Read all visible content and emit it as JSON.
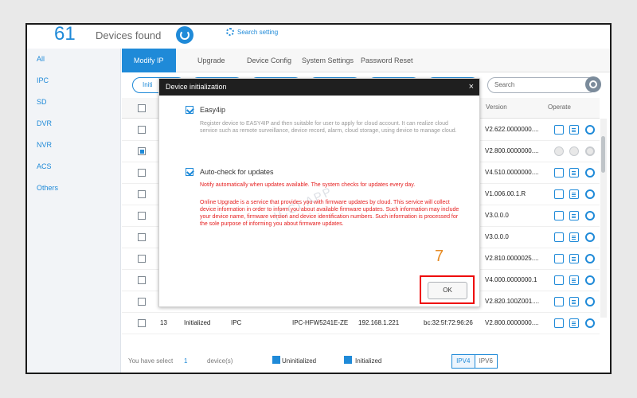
{
  "top": {
    "count": "61",
    "found_label": "Devices found",
    "search_setting": "Search setting"
  },
  "sidebar": {
    "items": [
      {
        "label": "All"
      },
      {
        "label": "IPC"
      },
      {
        "label": "SD"
      },
      {
        "label": "DVR"
      },
      {
        "label": "NVR"
      },
      {
        "label": "ACS"
      },
      {
        "label": "Others"
      }
    ]
  },
  "tabs": [
    {
      "label": "Modify IP"
    },
    {
      "label": "Upgrade"
    },
    {
      "label": "Device Config"
    },
    {
      "label": "System Settings"
    },
    {
      "label": "Password Reset"
    }
  ],
  "toolbar": {
    "visible_button_label": "Initi",
    "search_placeholder": "Search"
  },
  "table": {
    "version_header": "Version",
    "operate_header": "Operate",
    "rows": [
      {
        "version": "V2.622.0000000....",
        "selected": false,
        "operate_enabled": true
      },
      {
        "version": "V2.800.0000000....",
        "selected": true,
        "operate_enabled": false
      },
      {
        "version": "V4.510.0000000....",
        "selected": false,
        "operate_enabled": true
      },
      {
        "version": "V1.006.00.1.R",
        "selected": false,
        "operate_enabled": true
      },
      {
        "version": "V3.0.0.0",
        "selected": false,
        "operate_enabled": true
      },
      {
        "version": "V3.0.0.0",
        "selected": false,
        "operate_enabled": true
      },
      {
        "version": "V2.810.0000025....",
        "selected": false,
        "operate_enabled": true
      },
      {
        "version": "V4.000.0000000.1",
        "selected": false,
        "operate_enabled": true
      },
      {
        "version": "V2.820.100Z001....",
        "selected": false,
        "operate_enabled": true
      }
    ],
    "last_row": {
      "no": "13",
      "status": "Initialized",
      "type": "IPC",
      "model": "IPC-HFW5241E-ZE",
      "ip": "192.168.1.221",
      "mac": "bc:32:5f:72:96:26",
      "version": "V2.800.0000000...."
    }
  },
  "footer": {
    "selected_prefix": "You have select",
    "selected_count": "1",
    "selected_suffix": "device(s)",
    "uninitialized_label": "Uninitialized",
    "initialized_label": "Initialized",
    "ipv4": "IPV4",
    "ipv6": "IPV6"
  },
  "dialog": {
    "title": "Device initialization",
    "close": "×",
    "easy4ip_label": "Easy4ip",
    "easy4ip_desc": "Register device to EASY4IP and then suitable for user to apply for cloud account. It can realize cloud service such as remote surveillance, device record, alarm, cloud storage, using device to manage cloud.",
    "autocheck_label": "Auto-check for updates",
    "autocheck_warning": "Notify automatically when updates available. The system checks for updates every day.",
    "online_upgrade_text": "Online Upgrade is a service that provides you with firmware updates by cloud. This service will collect device information in order to inform you about available firmware updates. Such information may include your device name, firmware version and device identification numbers. Such information is processed for the sole purpose of informing you about firmware updates.",
    "ok_label": "OK",
    "step_number": "7",
    "watermark": "ICCI APP"
  },
  "colors": {
    "accent": "#1f8ad8",
    "alert": "#e00000",
    "step": "#e68b24"
  }
}
